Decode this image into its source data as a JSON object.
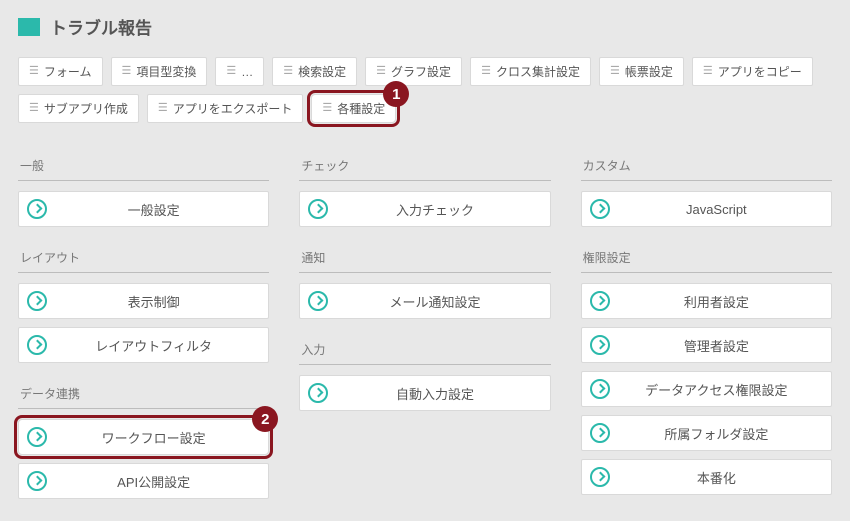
{
  "header": {
    "title": "トラブル報告"
  },
  "tabs": [
    {
      "label": "フォーム"
    },
    {
      "label": "項目型変換"
    },
    {
      "label": "…"
    },
    {
      "label": "検索設定"
    },
    {
      "label": "グラフ設定"
    },
    {
      "label": "クロス集計設定"
    },
    {
      "label": "帳票設定"
    },
    {
      "label": "アプリをコピー"
    },
    {
      "label": "サブアプリ作成"
    },
    {
      "label": "アプリをエクスポート"
    },
    {
      "label": "各種設定"
    }
  ],
  "annotations": {
    "badge1": "1",
    "badge2": "2"
  },
  "columns": {
    "left": [
      {
        "section": "一般",
        "items": [
          "一般設定"
        ]
      },
      {
        "section": "レイアウト",
        "items": [
          "表示制御",
          "レイアウトフィルタ"
        ]
      },
      {
        "section": "データ連携",
        "items": [
          "ワークフロー設定",
          "API公開設定"
        ]
      }
    ],
    "middle": [
      {
        "section": "チェック",
        "items": [
          "入力チェック"
        ]
      },
      {
        "section": "通知",
        "items": [
          "メール通知設定"
        ]
      },
      {
        "section": "入力",
        "items": [
          "自動入力設定"
        ]
      }
    ],
    "right": [
      {
        "section": "カスタム",
        "items": [
          "JavaScript"
        ]
      },
      {
        "section": "権限設定",
        "items": [
          "利用者設定",
          "管理者設定",
          "データアクセス権限設定",
          "所属フォルダ設定",
          "本番化"
        ]
      }
    ]
  }
}
